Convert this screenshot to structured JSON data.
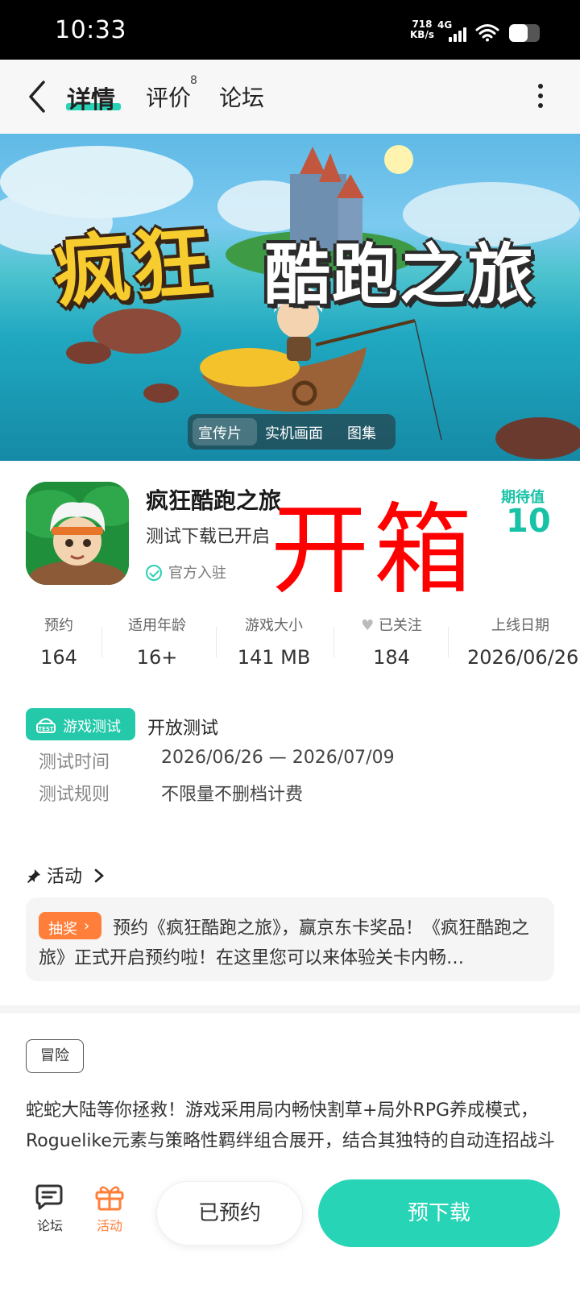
{
  "status_bar": {
    "time": "10:33",
    "net_speed": "718",
    "net_unit": "KB/s",
    "network": "4G",
    "battery_level": 0.6
  },
  "nav": {
    "tabs": [
      {
        "label": "详情",
        "active": true
      },
      {
        "label": "评价",
        "badge": "8"
      },
      {
        "label": "论坛"
      }
    ]
  },
  "banner": {
    "title_left": "疯狂",
    "title_right": "酷跑之旅",
    "media_tabs": [
      {
        "label": "宣传片",
        "selected": true
      },
      {
        "label": "实机画面"
      },
      {
        "label": "图集"
      }
    ]
  },
  "game": {
    "name": "疯狂酷跑之旅",
    "status": "测试下载已开启",
    "official": "官方入驻",
    "expect_label": "期待值",
    "expect_value": "10",
    "overlay_text": "开箱"
  },
  "stats": [
    {
      "label": "预约",
      "value": "164"
    },
    {
      "label": "适用年龄",
      "value": "16+"
    },
    {
      "label": "游戏大小",
      "value": "141 MB"
    },
    {
      "label": "已关注",
      "value": "184"
    },
    {
      "label": "上线日期",
      "value": "2026/06/26"
    }
  ],
  "test": {
    "badge": "游戏测试",
    "type": "开放测试",
    "rows": [
      {
        "key": "测试时间",
        "value": "2026/06/26 — 2026/07/09"
      },
      {
        "key": "测试规则",
        "value": "不限量不删档计费"
      }
    ]
  },
  "activity": {
    "heading": "活动",
    "tag": "抽奖",
    "text": "预约《疯狂酷跑之旅》，赢京东卡奖品！《疯狂酷跑之旅》正式开启预约啦！在这里您可以来体验关卡内畅…"
  },
  "genre_tag": "冒险",
  "description": "蛇蛇大陆等你拯救！游戏采用局内畅快割草+局外RPG养成模式，Roguelike元素与策略性羁绊组合展开，结合其独特的自动连招战斗和秘宝养成系统，形成了Roguelike与技能组合",
  "bottom_bar": {
    "forum": "论坛",
    "activity": "活动",
    "reserved": "已预约",
    "predownload": "预下载"
  },
  "colors": {
    "accent": "#27d4b6",
    "lottery": "#ff7f3a",
    "overlay": "#ff0000"
  }
}
